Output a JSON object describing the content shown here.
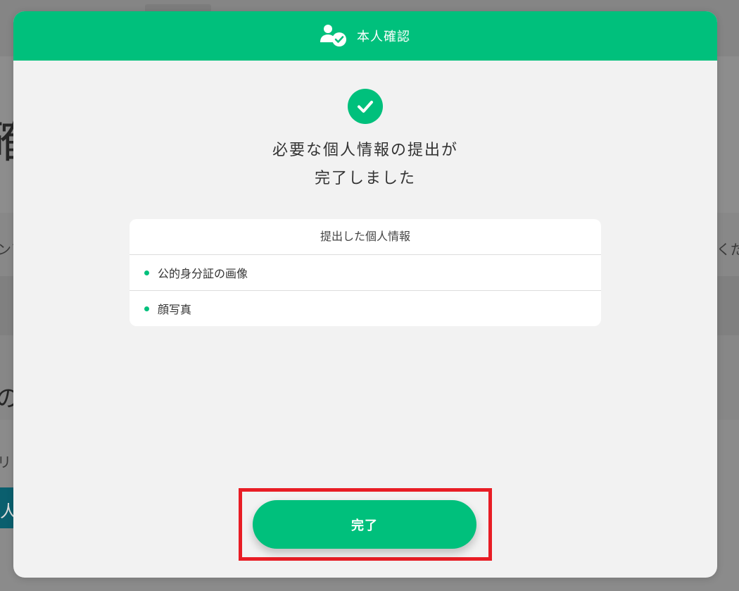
{
  "colors": {
    "accent": "#00c07c",
    "highlight": "#e81d25",
    "modal_background": "#f2f2f2"
  },
  "background": {
    "big_text": "確",
    "left_text_1": "ンア",
    "right_text_1": "くだ",
    "left_text_2": "の",
    "left_text_3": "リ",
    "teal_button_text": "人"
  },
  "modal": {
    "header": {
      "icon": "user-check-icon",
      "title": "本人確認"
    },
    "status_icon": "check-circle-icon",
    "headline_line1": "必要な個人情報の提出が",
    "headline_line2": "完了しました",
    "card": {
      "title": "提出した個人情報",
      "items": [
        "公的身分証の画像",
        "顔写真"
      ]
    },
    "done_button_label": "完了"
  }
}
